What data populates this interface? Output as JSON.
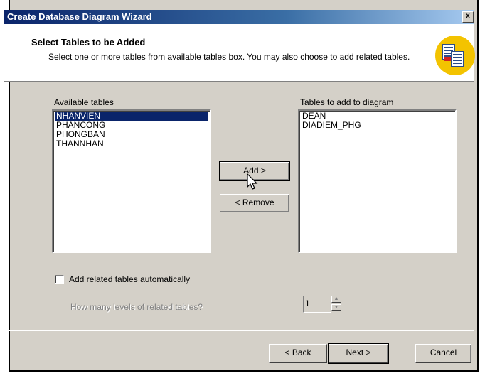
{
  "window": {
    "title": "Create Database Diagram Wizard",
    "close_glyph": "x"
  },
  "header": {
    "title": "Select Tables to be Added",
    "description": "Select one or more tables from available tables box. You may also choose to add related tables.",
    "icon": "wizard-tables-icon"
  },
  "available": {
    "label": "Available tables",
    "items": [
      "NHANVIEN",
      "PHANCONG",
      "PHONGBAN",
      "THANNHAN"
    ],
    "selected": "NHANVIEN"
  },
  "target": {
    "label": "Tables to add to diagram",
    "items": [
      "DEAN",
      "DIADIEM_PHG"
    ]
  },
  "buttons": {
    "add": "Add >",
    "remove": "< Remove",
    "back": "< Back",
    "next": "Next >",
    "cancel": "Cancel"
  },
  "options": {
    "related_label": "Add related tables automatically",
    "related_checked": false,
    "levels_label": "How many levels of related tables?",
    "levels_value": "1"
  },
  "colors": {
    "titlebar": "#0a246a",
    "selection": "#0a246a",
    "dialog_bg": "#d4d0c8",
    "icon_bg": "#f3c300"
  }
}
